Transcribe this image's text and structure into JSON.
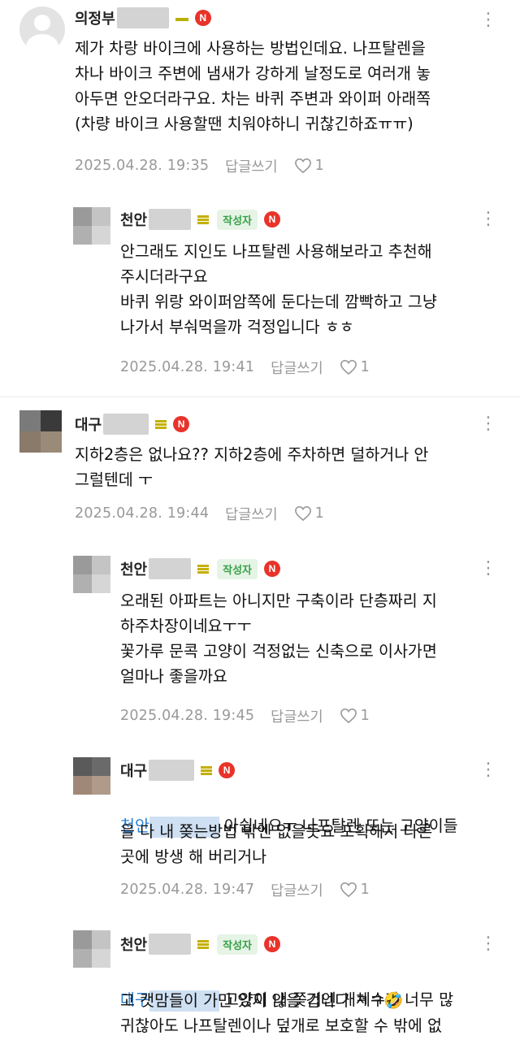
{
  "comments": [
    {
      "nickname": "의정부",
      "author": false,
      "text": "제가 차랑 바이크에 사용하는 방법인데요. 나프탈렌을\n차나 바이크 주변에 냄새가 강하게 날정도로 여러개 놓\n아두면 안오더라구요. 차는 바퀴 주변과 와이퍼 아래쪽\n(차량 바이크 사용할땐 치워야하니 귀찮긴하죠ㅠㅠ)",
      "date": "2025.04.28. 19:35",
      "reply_label": "답글쓰기",
      "likes": "1"
    },
    {
      "nickname": "천안",
      "author": true,
      "author_label": "작성자",
      "text": "안그래도 지인도 나프탈렌 사용해보라고 추천해\n주시더라구요\n바퀴 위랑 와이퍼암쪽에 둔다는데 깜빡하고 그냥\n나가서 부숴먹을까 걱정입니다 ㅎㅎ",
      "date": "2025.04.28. 19:41",
      "reply_label": "답글쓰기",
      "likes": "1"
    },
    {
      "nickname": "대구",
      "author": false,
      "text": "지하2층은 없나요?? 지하2층에 주차하면 덜하거나 안\n그럴텐데 ㅜ",
      "date": "2025.04.28. 19:44",
      "reply_label": "답글쓰기",
      "likes": "1"
    },
    {
      "nickname": "천안",
      "author": true,
      "author_label": "작성자",
      "text": "오래된 아파트는 아니지만 구축이라 단층짜리 지\n하주차장이네요ㅜㅜ\n꽃가루 문콕 고양이 걱정없는 신축으로 이사가면\n얼마나 좋을까요",
      "date": "2025.04.28. 19:45",
      "reply_label": "답글쓰기",
      "likes": "1"
    },
    {
      "nickname": "대구",
      "author": false,
      "mention": "천안",
      "text_line1": "아쉽네요ㅜ 나프탈렌 또는 고양이들",
      "text": "을 다 내 쫒는방법 밖엔 없을듯요 포획해서 다른\n곳에 방생 해 버리거나",
      "date": "2025.04.28. 19:47",
      "reply_label": "답글쓰기",
      "likes": "1"
    },
    {
      "nickname": "천안",
      "author": true,
      "author_label": "작성자",
      "mention": "대구",
      "text_line1": "고양이 내 쫒기엔 개체수가 너무 많",
      "text": "고 캣맘들이 가만 있지 않을 겁니다 ㅋㅋ🤣\n귀찮아도 나프탈렌이나 덮개로 보호할 수 밖에 없"
    }
  ]
}
